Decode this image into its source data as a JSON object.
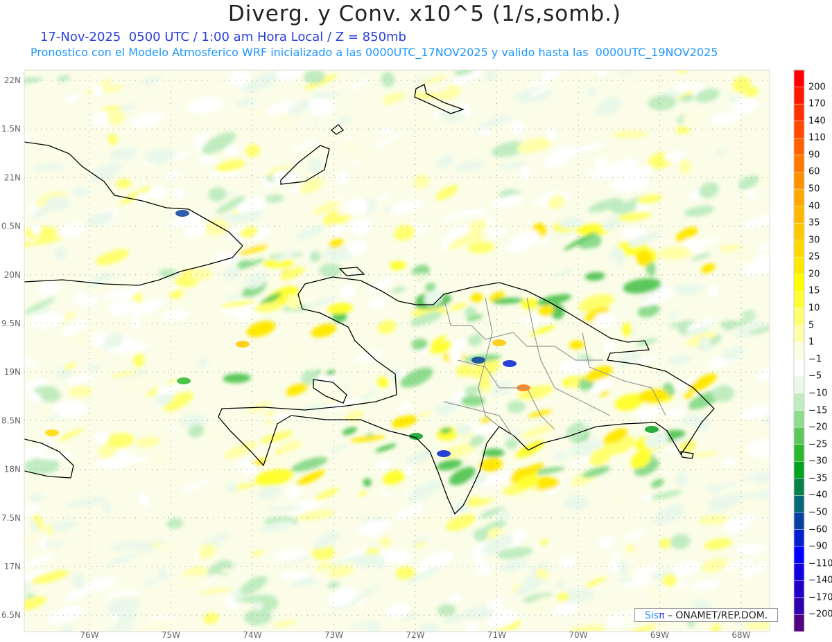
{
  "header": {
    "title": "Diverg. y Conv. x10^5 (1/s,somb.)",
    "subtitle_time": "17-Nov-2025  0500 UTC / 1:00 am Hora Local / Z = 850mb",
    "subtitle_model": "Pronostico con el Modelo Atmosferico WRF inicializado a las 0000UTC_17NOV2025 y valido hasta las  0000UTC_19NOV2025"
  },
  "axes": {
    "lat_labels": [
      "22N",
      "1.5N",
      "21N",
      "0.5N",
      "20N",
      "9.5N",
      "19N",
      "8.5N",
      "18N",
      "7.5N",
      "17N",
      "6.5N"
    ],
    "lon_labels": [
      "76W",
      "75W",
      "74W",
      "73W",
      "72W",
      "71W",
      "70W",
      "69W",
      "68W"
    ]
  },
  "colorbar": {
    "labels": [
      "200",
      "170",
      "140",
      "110",
      "90",
      "60",
      "50",
      "40",
      "35",
      "30",
      "25",
      "20",
      "15",
      "10",
      "5",
      "1",
      "-1",
      "-5",
      "-10",
      "-15",
      "-20",
      "-25",
      "-30",
      "-35",
      "-40",
      "-50",
      "-60",
      "-90",
      "-110",
      "-140",
      "-170",
      "-200"
    ],
    "colors": [
      "#ff0000",
      "#ff1800",
      "#ff3000",
      "#ff4800",
      "#ff6000",
      "#ff7800",
      "#ff9000",
      "#ffa800",
      "#ffb800",
      "#ffc800",
      "#ffd800",
      "#ffe800",
      "#ffff00",
      "#ffff30",
      "#ffff70",
      "#ffffa8",
      "#fdfde2",
      "#ffffff",
      "#eaf8ea",
      "#c0ecc0",
      "#8edc8e",
      "#5cc85c",
      "#2cb82c",
      "#00a020",
      "#088048",
      "#056878",
      "#0840a0",
      "#0020d0",
      "#0000ff",
      "#1000e0",
      "#2000c8",
      "#3000b0",
      "#500080"
    ]
  },
  "credit": {
    "sis": "Sis",
    "pi": "π",
    "org": " – ONAMET/REP.DOM."
  }
}
